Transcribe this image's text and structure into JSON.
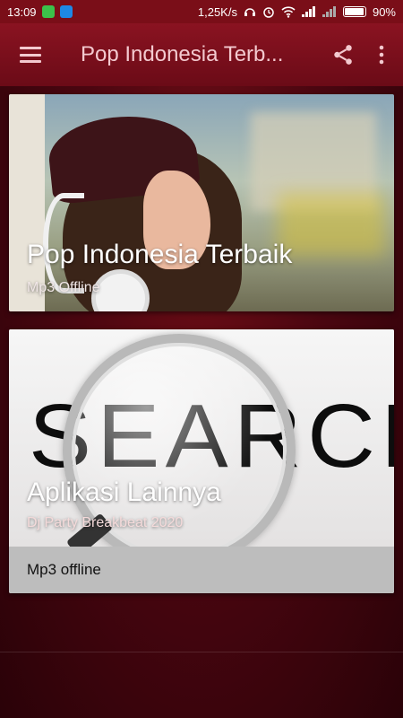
{
  "status_bar": {
    "time": "13:09",
    "network_speed": "1,25K/s",
    "battery": "90%"
  },
  "app_bar": {
    "title": "Pop Indonesia Terb..."
  },
  "cards": [
    {
      "title": "Pop Indonesia Terbaik",
      "subtitle": "Mp3 Offline"
    },
    {
      "title": "Aplikasi Lainnya",
      "subtitle": "Dj Party Breakbeat 2020",
      "footer": "Mp3 offline",
      "image_text": "SEARCH"
    }
  ],
  "colors": {
    "appbar": "#7a0e18",
    "accent_text": "#f3c9cf"
  }
}
